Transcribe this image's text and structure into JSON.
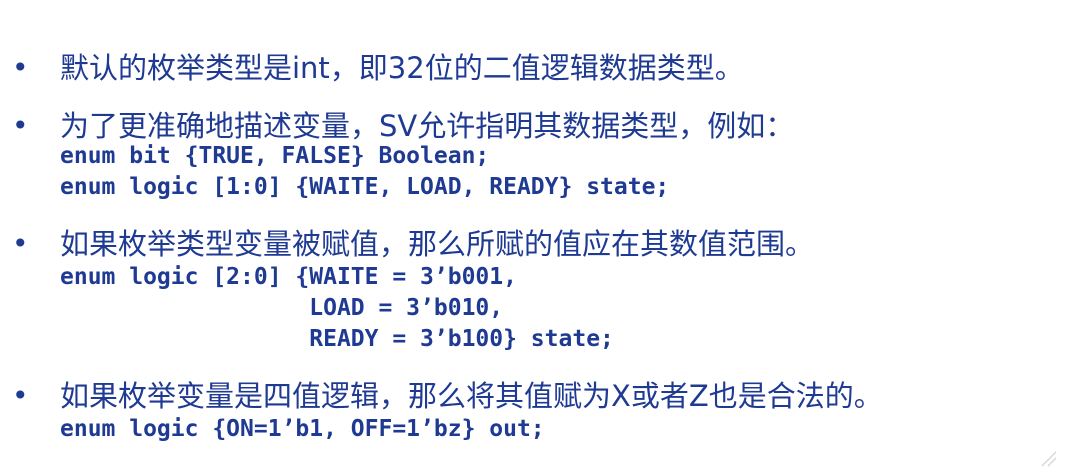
{
  "bullets": [
    {
      "marker": "•",
      "text": "默认的枚举类型是int，即32位的二值逻辑数据类型。",
      "code": []
    },
    {
      "marker": "•",
      "text": "为了更准确地描述变量，SV允许指明其数据类型，例如：",
      "code": [
        "enum bit {TRUE, FALSE} Boolean;",
        "enum logic [1:0] {WAITE, LOAD, READY} state;"
      ]
    },
    {
      "marker": "•",
      "text": "如果枚举类型变量被赋值，那么所赋的值应在其数值范围。",
      "code": [
        "enum logic [2:0] {WAITE = 3’b001,",
        "                  LOAD = 3’b010,",
        "                  READY = 3’b100} state;"
      ]
    },
    {
      "marker": "•",
      "text": "如果枚举变量是四值逻辑，那么将其值赋为X或者Z也是合法的。",
      "code": [
        "enum logic {ON=1’b1, OFF=1’bz} out;"
      ]
    }
  ],
  "colors": {
    "text": "#1f3a93",
    "background": "#ffffff"
  }
}
